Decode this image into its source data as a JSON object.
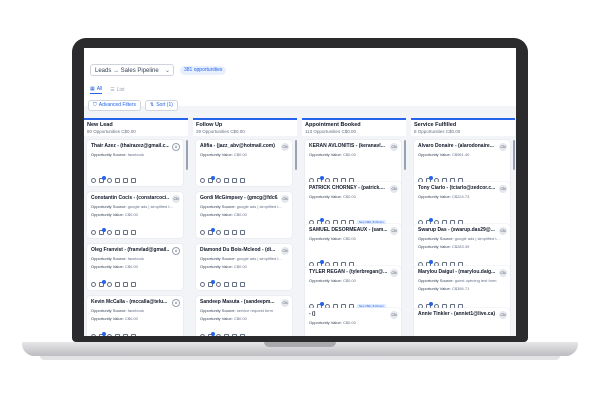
{
  "header": {
    "pipeline_select": "Leads → Sales Pipeline",
    "opportunities_count": "381 opportunities",
    "tabs": [
      {
        "label": "All"
      },
      {
        "label": "List"
      }
    ],
    "advanced_filters": "Advanced Filters",
    "sort": "Sort (1)"
  },
  "labels": {
    "source": "Opportunity Source:",
    "value": "Opportunity Value:"
  },
  "columns": [
    {
      "title": "New Lead",
      "sub": "80 Opportunities  C$0.00",
      "cards": [
        {
          "name": "Thair Azez - (thairazez@gmail.c...",
          "source": "facebook",
          "value": "",
          "avatar": "A"
        },
        {
          "name": "Constantin Cocis - (constarcoci...",
          "source": "google ads | simplified t...",
          "value": "C$0.00",
          "avatar": "CN"
        },
        {
          "name": "Oleg Franvist - (franvlad@gmail....",
          "source": "facebook",
          "value": "C$0.00",
          "avatar": "A"
        },
        {
          "name": "Kevin McCalla - (mccalla@telu...",
          "source": "facebook",
          "value": "C$0.00",
          "avatar": "A"
        }
      ]
    },
    {
      "title": "Follow Up",
      "sub": "29 Opportunities  C$0.00",
      "cards": [
        {
          "name": "Alifia - (jazz_abv@hotmail.com)",
          "source": "",
          "value": "C$0.00",
          "avatar": "CN"
        },
        {
          "name": "Gordi McGimpsey - (gmcg@fdc6...",
          "source": "google ads | simplified t...",
          "value": "C$0.00",
          "avatar": "CN"
        },
        {
          "name": "Diamond Du Bois-Mcleod - (di...",
          "source": "google ads | simplified t...",
          "value": "C$0.00",
          "avatar": "CN"
        },
        {
          "name": "Sandeep Masuta - (sandeepm...",
          "source": "service request form",
          "value": "C$0.00",
          "avatar": "CN"
        }
      ]
    },
    {
      "title": "Appointment Booked",
      "sub": "113 Opportunities  C$0.00",
      "cards": [
        {
          "name": "KERAN AVLONITIS - (keranavl...",
          "source": "",
          "value": "C$0.00",
          "avatar": "CN",
          "tag": ""
        },
        {
          "name": "PATRICK CHORNEY - (patrick....",
          "source": "",
          "value": "C$0.00",
          "avatar": "CN",
          "tag": "Nov 19th, 8:30 am"
        },
        {
          "name": "SAMUEL DESORMEAUX - (sam...",
          "source": "",
          "value": "C$0.00",
          "avatar": "CN",
          "tag": ""
        },
        {
          "name": "TYLER REGAN - (tylerbregan@...",
          "source": "",
          "value": "C$0.00",
          "avatar": "CN",
          "tag": "Nov 15th, 8:00 am"
        },
        {
          "name": "- ()",
          "source": "",
          "value": "C$0.00",
          "avatar": "CN",
          "tag": ""
        }
      ]
    },
    {
      "title": "Service Fulfilled",
      "sub": "8 Opportunities  C$0.00",
      "cards": [
        {
          "name": "Alvaro Donaire - (alarodonaire...",
          "source": "",
          "value": "C$961.40",
          "avatar": "CN"
        },
        {
          "name": "Tony Ciarlo - (tciarlo@zedcor.c...",
          "source": "",
          "value": "C$224.73",
          "avatar": "CN"
        },
        {
          "name": "Swarup Das - (swarup.das29@...",
          "source": "google ads | simplified t...",
          "value": "C$283.39",
          "avatar": "CN"
        },
        {
          "name": "Marylou Daigul - (marylou.daig...",
          "source": "guest opening test form",
          "value": "C$356.71",
          "avatar": "CN"
        },
        {
          "name": "Annie Tinkler - (anniet1@live.ca)",
          "source": "",
          "value": "",
          "avatar": "CN"
        }
      ]
    }
  ]
}
